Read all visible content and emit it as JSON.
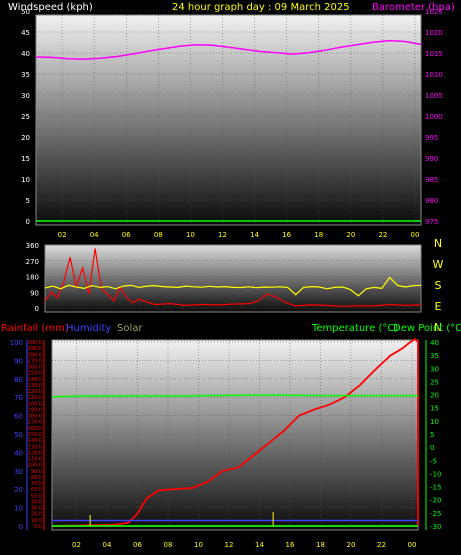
{
  "colors": {
    "background": "#000000",
    "wind": "#ffffff",
    "barometer": "#ff00ff",
    "title": "#ffff00",
    "direction": "#ffff00",
    "rainfall": "#ff0000",
    "humidity": "#4040ff",
    "solar": "#a0a060",
    "temperature": "#00ff00",
    "dewpoint": "#00ff00",
    "tick": "#ffff00"
  },
  "chart_data": [
    {
      "type": "line",
      "title": "24 hour graph day : 09 March 2025",
      "y_left_label": "Windspeed (kph)",
      "y_right_label": "Barometer (hpa)",
      "x_ticks": [
        "02",
        "04",
        "06",
        "08",
        "10",
        "12",
        "14",
        "16",
        "18",
        "20",
        "22",
        "00"
      ],
      "y_left_ticks": [
        "0",
        "5",
        "10",
        "15",
        "20",
        "25",
        "30",
        "35",
        "40",
        "45",
        "50"
      ],
      "y_right_ticks": [
        "975",
        "980",
        "985",
        "990",
        "995",
        "1000",
        "1005",
        "1010",
        "1015",
        "1020",
        "1025"
      ],
      "ylim_left": [
        0,
        50
      ],
      "ylim_right": [
        975,
        1025
      ],
      "x_range": [
        0,
        24
      ],
      "series": [
        {
          "name": "Windspeed (kph)",
          "axis": "left",
          "x": [
            0,
            24
          ],
          "values": [
            0,
            0
          ]
        },
        {
          "name": "Barometer (hpa)",
          "axis": "right",
          "x": [
            0,
            1,
            2,
            3,
            4,
            5,
            6,
            7,
            8,
            9,
            10,
            11,
            12,
            13,
            14,
            15,
            16,
            17,
            18,
            19,
            20,
            21,
            22,
            23,
            24
          ],
          "values": [
            1015.0,
            1014.9,
            1014.6,
            1014.5,
            1014.7,
            1015.1,
            1015.7,
            1016.4,
            1017.0,
            1017.6,
            1017.9,
            1017.8,
            1017.3,
            1016.8,
            1016.3,
            1016.0,
            1015.7,
            1016.0,
            1016.6,
            1017.3,
            1017.9,
            1018.5,
            1018.9,
            1018.7,
            1018.0
          ]
        }
      ]
    },
    {
      "type": "line",
      "title": "",
      "y_left_ticks": [
        "0",
        "90",
        "180",
        "270",
        "360"
      ],
      "y_right_ticks": [
        "N",
        "W",
        "S",
        "E",
        "N"
      ],
      "ylim": [
        0,
        360
      ],
      "x_range": [
        0,
        24
      ],
      "series": [
        {
          "name": "Wind direction",
          "color_key": "direction",
          "x": [
            0,
            0.5,
            1,
            1.5,
            2,
            2.5,
            3,
            3.5,
            4,
            4.5,
            5,
            5.5,
            6,
            6.5,
            7,
            7.5,
            8,
            8.5,
            9,
            9.5,
            10,
            10.5,
            11,
            11.5,
            12,
            12.5,
            13,
            13.5,
            14,
            14.5,
            15,
            15.5,
            16,
            16.5,
            17,
            17.5,
            18,
            18.5,
            19,
            19.5,
            20,
            20.5,
            21,
            21.5,
            22,
            22.5,
            23,
            23.5,
            24
          ],
          "values": [
            115,
            125,
            110,
            130,
            120,
            112,
            128,
            118,
            122,
            110,
            125,
            130,
            118,
            125,
            128,
            122,
            120,
            118,
            125,
            121,
            119,
            124,
            120,
            122,
            118,
            117,
            121,
            116,
            120,
            119,
            121,
            118,
            76,
            118,
            122,
            120,
            110,
            118,
            120,
            105,
            70,
            110,
            118,
            112,
            175,
            130,
            120,
            128,
            130
          ]
        },
        {
          "name": "Wind gust",
          "color_key": "rainfall",
          "x": [
            0,
            0.4,
            0.8,
            1.2,
            1.6,
            2.0,
            2.4,
            2.8,
            3.2,
            3.6,
            4.0,
            4.4,
            4.8,
            5.2,
            5.6,
            6.0,
            7,
            8,
            9,
            10,
            11,
            12,
            13,
            13.6,
            14.2,
            14.8,
            15.4,
            16,
            17,
            18,
            19,
            20,
            21,
            22,
            23,
            24
          ],
          "values": [
            40,
            90,
            60,
            150,
            290,
            120,
            230,
            80,
            340,
            110,
            80,
            40,
            120,
            60,
            30,
            50,
            20,
            25,
            15,
            20,
            18,
            22,
            25,
            40,
            80,
            60,
            30,
            12,
            18,
            15,
            10,
            12,
            12,
            20,
            15,
            18
          ]
        }
      ]
    },
    {
      "type": "line",
      "title": "",
      "legend": [
        "Rainfall (mm)",
        "Humidity",
        "Solar",
        "Temperature (°C)",
        "Dew Point (°C)"
      ],
      "x_ticks": [
        "02",
        "04",
        "06",
        "08",
        "10",
        "12",
        "14",
        "16",
        "18",
        "20",
        "22",
        "00"
      ],
      "y_humidity_ticks": [
        "0",
        "10",
        "20",
        "30",
        "40",
        "50",
        "60",
        "70",
        "80",
        "90",
        "100"
      ],
      "y_rain_ticks": [
        "0.0",
        "10.0",
        "20.0",
        "30.0",
        "40.0",
        "50.0",
        "60.0",
        "70.0",
        "80.0",
        "90.0",
        "100.0",
        "110.0",
        "120.0",
        "130.0",
        "140.0",
        "150.0",
        "160.0",
        "170.0",
        "180.0",
        "190.0",
        "200.0",
        "210.0",
        "220.0",
        "230.0",
        "240.0",
        "250.0",
        "260.0",
        "270.0",
        "280.0",
        "290.0",
        "300.0"
      ],
      "y_temp_ticks": [
        "40",
        "35",
        "30",
        "25",
        "20",
        "15",
        "10",
        "5",
        "0",
        "-5",
        "-10",
        "-15",
        "-20",
        "-25",
        "-30"
      ],
      "ylim_humidity": [
        0,
        100
      ],
      "ylim_rain": [
        0,
        300
      ],
      "ylim_temp": [
        -30,
        40
      ],
      "x_range": [
        0,
        24
      ],
      "series": [
        {
          "name": "Rainfall (mm)",
          "axis": "rain",
          "color_key": "rainfall",
          "x": [
            0,
            4,
            5,
            5.6,
            6.2,
            7.0,
            8.0,
            9.2,
            10.2,
            11.2,
            12.2,
            13.2,
            14.2,
            15.2,
            16.2,
            17.2,
            18.2,
            19.2,
            20.2,
            21.2,
            22.2,
            23.0,
            23.5,
            23.8,
            24,
            24
          ],
          "values": [
            0,
            2,
            5,
            20,
            45,
            58,
            60,
            62,
            72,
            90,
            95,
            115,
            135,
            155,
            180,
            190,
            198,
            210,
            230,
            255,
            278,
            290,
            300,
            305,
            300,
            0
          ]
        },
        {
          "name": "Humidity",
          "axis": "humidity",
          "color_key": "humidity",
          "x": [
            0,
            24
          ],
          "values": [
            3,
            3
          ]
        },
        {
          "name": "Solar",
          "axis": "humidity",
          "color_key": "solar",
          "x": [
            0,
            24
          ],
          "values": [
            0,
            0
          ]
        },
        {
          "name": "Temperature (°C)",
          "axis": "temp",
          "color_key": "temperature",
          "x": [
            0,
            2,
            4,
            6,
            8,
            10,
            12,
            14,
            16,
            18,
            20,
            22,
            24
          ],
          "values": [
            19.2,
            19.4,
            19.4,
            19.5,
            19.4,
            19.6,
            19.7,
            19.8,
            19.7,
            19.6,
            19.6,
            19.6,
            19.6
          ]
        },
        {
          "name": "Dew Point (°C)",
          "axis": "temp",
          "color_key": "dewpoint",
          "x": [
            0,
            24
          ],
          "values": [
            -30,
            -30
          ]
        }
      ]
    }
  ]
}
